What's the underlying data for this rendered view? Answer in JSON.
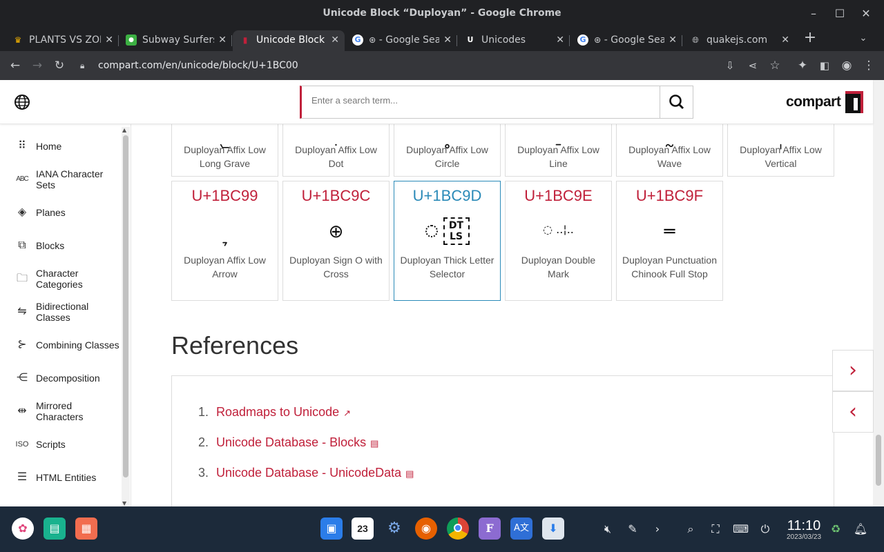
{
  "window": {
    "title": "Unicode Block “Duployan” - Google Chrome"
  },
  "tabs": [
    {
      "label": "PLANTS VS ZOMBIES",
      "favicon": "crown-icon",
      "active": false
    },
    {
      "label": "Subway Surfers",
      "favicon": "game-icon",
      "active": false
    },
    {
      "label": "Unicode Block “Duployan”",
      "favicon": "compart-icon",
      "active": true
    },
    {
      "label": "𛲜 - Google Search",
      "favicon": "google-icon",
      "active": false
    },
    {
      "label": "Unicodes",
      "favicon": "unicodes-icon",
      "active": false
    },
    {
      "label": "𛲜 - Google Search",
      "favicon": "google-icon",
      "active": false
    },
    {
      "label": "quakejs.com",
      "favicon": "globe-icon",
      "active": false
    }
  ],
  "address": {
    "url": "compart.com/en/unicode/block/U+1BC00"
  },
  "search": {
    "placeholder": "Enter a search term..."
  },
  "logo": {
    "text": "compart"
  },
  "sidebar": {
    "items": [
      {
        "label": "Home",
        "icon": "grid-icon"
      },
      {
        "label": "IANA Character Sets",
        "icon": "abcd-icon"
      },
      {
        "label": "Planes",
        "icon": "layers-icon"
      },
      {
        "label": "Blocks",
        "icon": "blocks-icon"
      },
      {
        "label": "Character Categories",
        "icon": "folder-icon"
      },
      {
        "label": "Bidirectional Classes",
        "icon": "bidi-icon"
      },
      {
        "label": "Combining Classes",
        "icon": "combining-icon"
      },
      {
        "label": "Decomposition",
        "icon": "decomposition-icon"
      },
      {
        "label": "Mirrored Characters",
        "icon": "mirror-icon"
      },
      {
        "label": "Scripts",
        "icon": "iso-icon"
      },
      {
        "label": "HTML Entities",
        "icon": "list-icon"
      }
    ]
  },
  "cards_top": [
    {
      "glyph": "𛲓",
      "name": "Duployan Affix Low Long Grave"
    },
    {
      "glyph": "𛲔",
      "name": "Duployan Affix Low Dot"
    },
    {
      "glyph": "𛲕",
      "name": "Duployan Affix Low Circle"
    },
    {
      "glyph": "𛲖",
      "name": "Duployan Affix Low Line"
    },
    {
      "glyph": "𛲗",
      "name": "Duployan Affix Low Wave"
    },
    {
      "glyph": "𛲘",
      "name": "Duployan Affix Low Vertical"
    }
  ],
  "cards": [
    {
      "code": "U+1BC99",
      "glyph": "𛲙",
      "name": "Duployan Affix Low Arrow"
    },
    {
      "code": "U+1BC9C",
      "glyph": "⊕",
      "name": "Duployan Sign O with Cross"
    },
    {
      "code": "U+1BC9D",
      "glyph": "DT LS",
      "name": "Duployan Thick Letter Selector"
    },
    {
      "code": "U+1BC9E",
      "glyph": "◌ ..¦..",
      "name": "Duployan Double Mark"
    },
    {
      "code": "U+1BC9F",
      "glyph": "═",
      "name": "Duployan Punctuation Chinook Full Stop"
    }
  ],
  "references": {
    "heading": "References",
    "items": [
      {
        "num": "1.",
        "label": "Roadmaps to Unicode",
        "icon": "external-link-icon"
      },
      {
        "num": "2.",
        "label": "Unicode Database - Blocks",
        "icon": "document-icon"
      },
      {
        "num": "3.",
        "label": "Unicode Database - UnicodeData",
        "icon": "document-icon"
      }
    ]
  },
  "taskbar": {
    "time": "11:10",
    "date": "2023/03/23",
    "calendar_day": "23"
  },
  "colors": {
    "accent": "#c0203a",
    "selected": "#2a8ab8"
  }
}
